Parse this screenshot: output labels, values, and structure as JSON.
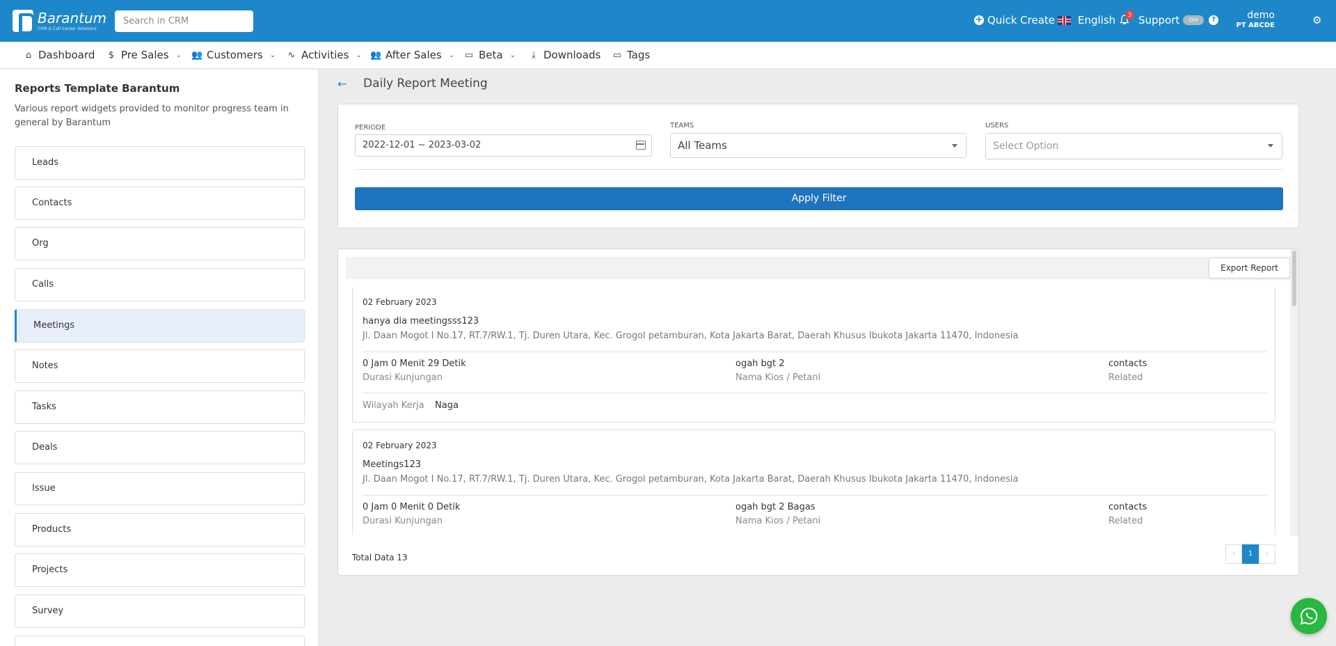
{
  "brand": {
    "name": "Barantum",
    "tagline": "CRM & Call Center Solutions"
  },
  "search": {
    "placeholder": "Search in CRM"
  },
  "topbar": {
    "quick_create": "Quick Create",
    "language": "English",
    "notification_count": "3",
    "support": "Support",
    "support_toggle": "OFF",
    "help": "?",
    "user_name": "demo",
    "user_company": "PT ABCDE"
  },
  "nav": {
    "dashboard": "Dashboard",
    "pre_sales": "Pre Sales",
    "customers": "Customers",
    "activities": "Activities",
    "after_sales": "After Sales",
    "beta": "Beta",
    "downloads": "Downloads",
    "tags": "Tags"
  },
  "sidebar": {
    "title": "Reports Template Barantum",
    "description": "Various report widgets provided to monitor progress team in general by Barantum",
    "items": [
      "Leads",
      "Contacts",
      "Org",
      "Calls",
      "Meetings",
      "Notes",
      "Tasks",
      "Deals",
      "Issue",
      "Products",
      "Projects",
      "Survey"
    ],
    "active": "Meetings"
  },
  "page": {
    "title": "Daily Report Meeting"
  },
  "filter": {
    "periode_label": "PERIODE",
    "periode_value": "2022-12-01 ~ 2023-03-02",
    "teams_label": "TEAMS",
    "teams_value": "All Teams",
    "users_label": "USERS",
    "users_placeholder": "Select Option",
    "apply_label": "Apply Filter"
  },
  "report": {
    "export_label": "Export Report",
    "meetings": [
      {
        "date": "02 February 2023",
        "title": "hanya dia meetingsss123",
        "address": "Jl. Daan Mogot I No.17, RT.7/RW.1, Tj. Duren Utara, Kec. Grogol petamburan, Kota Jakarta Barat, Daerah Khusus Ibukota Jakarta 11470, Indonesia",
        "duration": "0 Jam 0 Menit 29 Detik",
        "duration_label": "Durasi Kunjungan",
        "kios": "ogah bgt 2",
        "kios_label": "Nama Kios / Petani",
        "related": "contacts",
        "related_label": "Related",
        "wilayah_label": "Wilayah Kerja",
        "wilayah": "Naga"
      },
      {
        "date": "02 February 2023",
        "title": "Meetings123",
        "address": "Jl. Daan Mogot I No.17, RT.7/RW.1, Tj. Duren Utara, Kec. Grogol petamburan, Kota Jakarta Barat, Daerah Khusus Ibukota Jakarta 11470, Indonesia",
        "duration": "0 Jam 0 Menit 0 Detik",
        "duration_label": "Durasi Kunjungan",
        "kios": "ogah bgt 2 Bagas",
        "kios_label": "Nama Kios / Petani",
        "related": "contacts",
        "related_label": "Related"
      }
    ],
    "total_label": "Total Data 13",
    "pager": {
      "prev": "‹",
      "current": "1",
      "next": "›"
    }
  },
  "colors": {
    "primary": "#1e87c9",
    "apply": "#1e73be",
    "whatsapp": "#29b741"
  }
}
